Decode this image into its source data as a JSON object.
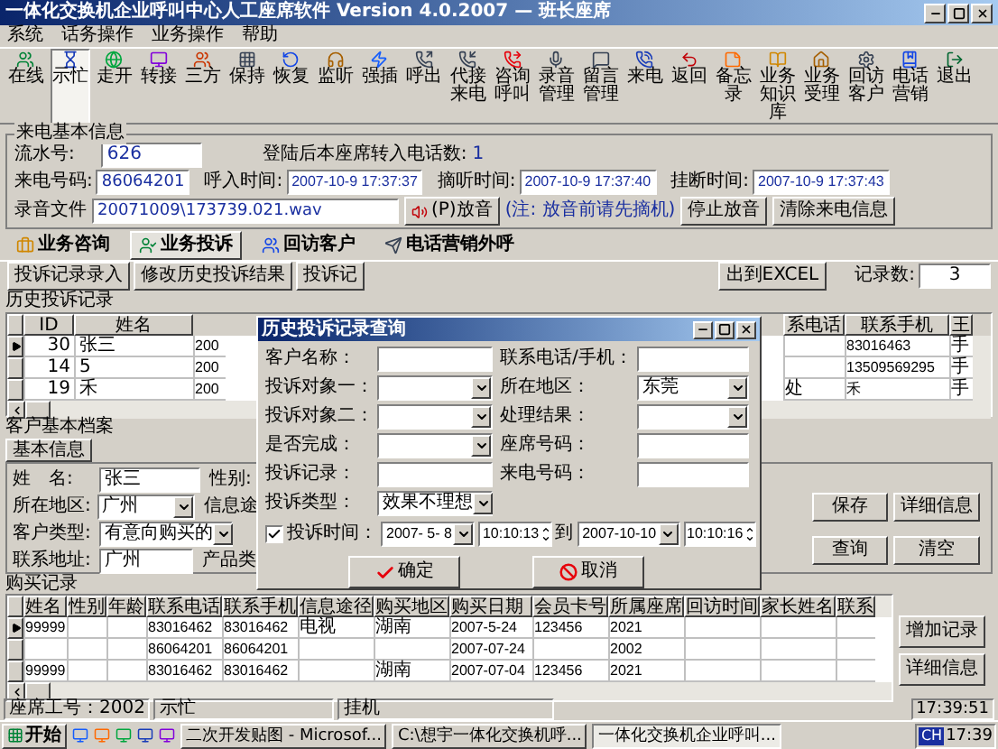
{
  "window": {
    "title": "一体化交换机企业呼叫中心人工座席软件 Version 4.0.2007 — 班长座席"
  },
  "menu": [
    "系统",
    "话务操作",
    "业务操作",
    "帮助"
  ],
  "toolbar": [
    {
      "label": "在线",
      "selected": false
    },
    {
      "label": "示忙",
      "selected": true
    },
    {
      "label": "走开",
      "selected": false
    },
    {
      "label": "转接",
      "selected": false
    },
    {
      "label": "三方",
      "selected": false
    },
    {
      "label": "保持",
      "selected": false
    },
    {
      "label": "恢复",
      "selected": false
    },
    {
      "label": "监听",
      "selected": false
    },
    {
      "label": "强插",
      "selected": false
    },
    {
      "label": "呼出",
      "selected": false
    },
    {
      "label": "代接来电",
      "selected": false
    },
    {
      "label": "咨询呼叫",
      "selected": false
    },
    {
      "label": "录音管理",
      "selected": false
    },
    {
      "label": "留言管理",
      "selected": false
    },
    {
      "label": "来电",
      "selected": false
    },
    {
      "label": "返回",
      "selected": false
    },
    {
      "label": "备忘录",
      "selected": false
    },
    {
      "label": "业务知识库",
      "selected": false
    },
    {
      "label": "业务受理",
      "selected": false
    },
    {
      "label": "回访客户",
      "selected": false
    },
    {
      "label": "电话营销",
      "selected": false
    },
    {
      "label": "退出",
      "selected": false
    }
  ],
  "call_info": {
    "title": "来电基本信息",
    "serial_label": "流水号:",
    "serial": "626",
    "count_label": "登陆后本座席转入电话数:",
    "count": "1",
    "caller_label": "来电号码:",
    "caller": "86064201",
    "incoming_label": "呼入时间:",
    "incoming": "2007-10-9 17:37:37",
    "answer_label": "摘听时间:",
    "answer": "2007-10-9 17:37:40",
    "hangup_label": "挂断时间:",
    "hangup": "2007-10-9 17:37:43",
    "recording_label": "录音文件",
    "recording": "20071009\\173739.021.wav",
    "play_button": "(P)放音",
    "note": "(注: 放音前请先摘机)",
    "buttons": [
      "停止放音",
      "清除来电信息"
    ]
  },
  "tabs": [
    {
      "label": "业务咨询",
      "selected": false
    },
    {
      "label": "业务投诉",
      "selected": true
    },
    {
      "label": "回访客户",
      "selected": false
    },
    {
      "label": "电话营销外呼",
      "selected": false
    }
  ],
  "complaints": {
    "buttons": [
      "投诉记录录入",
      "修改历史投诉结果",
      "投诉记"
    ],
    "export_button": "出到EXCEL",
    "count_label": "记录数:",
    "count": "3",
    "history": {
      "title": "历史投诉记录",
      "columns": [
        "ID",
        "姓名",
        "系电话",
        "联系手机",
        "王"
      ],
      "rows": [
        {
          "selected": true,
          "id": "30",
          "name": "张三",
          "column_3": "200",
          "mobile": "83016463",
          "column_6": "手"
        },
        {
          "selected": false,
          "id": "14",
          "name": "5",
          "column_3": "200",
          "mobile": "13509569295",
          "column_6": "手"
        },
        {
          "selected": false,
          "id": "19",
          "name": "禾",
          "column_3": "200",
          "column_4": "处",
          "mobile": "禾",
          "column_6": "手"
        }
      ]
    }
  },
  "profile": {
    "title": "客户基本档案",
    "tab": "基本信息",
    "name_label": "姓　名:",
    "name": "张三",
    "gender_label": "性别:",
    "region_label": "所在地区:",
    "region": "广州",
    "source_label": "信息途",
    "type_label": "客户类型:",
    "type": "有意向购买的",
    "product_label": "产品类",
    "address_label": "联系地址:",
    "address": "广州",
    "buttons": [
      "保存",
      "详细信息",
      "查询",
      "清空"
    ]
  },
  "purchases": {
    "title": "购买记录",
    "columns": [
      "姓名",
      "性别",
      "年龄",
      "联系电话",
      "联系手机",
      "信息途径",
      "购买地区",
      "购买日期",
      "会员卡号",
      "所属座席",
      "回访时间",
      "家长姓名",
      "联系"
    ],
    "rows": [
      {
        "selected": true,
        "name": "99999",
        "phone": "83016462",
        "mobile": "83016462",
        "source": "电视",
        "area": "湖南",
        "date": "2007-5-24",
        "card": "123456",
        "agent": "2021"
      },
      {
        "selected": false,
        "phone": "86064201",
        "mobile": "86064201",
        "date": "2007-07-24",
        "agent": "2002"
      },
      {
        "selected": false,
        "name": "99999",
        "phone": "83016462",
        "mobile": "83016462",
        "area": "湖南",
        "date": "2007-07-04",
        "card": "123456",
        "agent": "2021"
      }
    ],
    "buttons": [
      "增加记录",
      "详细信息"
    ]
  },
  "dialog": {
    "title": "历史投诉记录查询",
    "rows": [
      [
        {
          "kind": "input",
          "label": "客户名称："
        },
        {
          "kind": "input",
          "label": "联系电话/手机："
        }
      ],
      [
        {
          "kind": "select",
          "label": "投诉对象一："
        },
        {
          "kind": "select",
          "label": "所在地区：",
          "value": "东莞"
        }
      ],
      [
        {
          "kind": "select",
          "label": "投诉对象二："
        },
        {
          "kind": "select",
          "label": "处理结果："
        }
      ],
      [
        {
          "kind": "select",
          "label": "是否完成："
        },
        {
          "kind": "input",
          "label": "座席号码："
        }
      ],
      [
        {
          "kind": "input",
          "label": "投诉记录："
        },
        {
          "kind": "input",
          "label": "来电号码："
        }
      ],
      [
        {
          "kind": "select",
          "label": "投诉类型：",
          "value": "效果不理想"
        }
      ]
    ],
    "time": {
      "checked": true,
      "label": "投诉时间：",
      "from_date": "2007- 5- 8",
      "from_time": "10:10:13",
      "to_label": "到",
      "to_date": "2007-10-10",
      "to_time": "10:10:16"
    },
    "buttons": [
      {
        "kind": "ok",
        "label": "确定"
      },
      {
        "kind": "cancel",
        "label": "取消"
      }
    ]
  },
  "status_bar": {
    "items": [
      "座席工号：2002",
      "示忙",
      "挂机"
    ],
    "time": "17:39:51"
  },
  "taskbar": {
    "start": "开始",
    "tasks": [
      {
        "label": "二次开发贴图 - Microsof...",
        "selected": false
      },
      {
        "label": "C:\\想宇一体化交换机呼...",
        "selected": false
      },
      {
        "label": "一体化交换机企业呼叫...",
        "selected": true
      }
    ],
    "language": "CH",
    "clock": "17:39"
  }
}
